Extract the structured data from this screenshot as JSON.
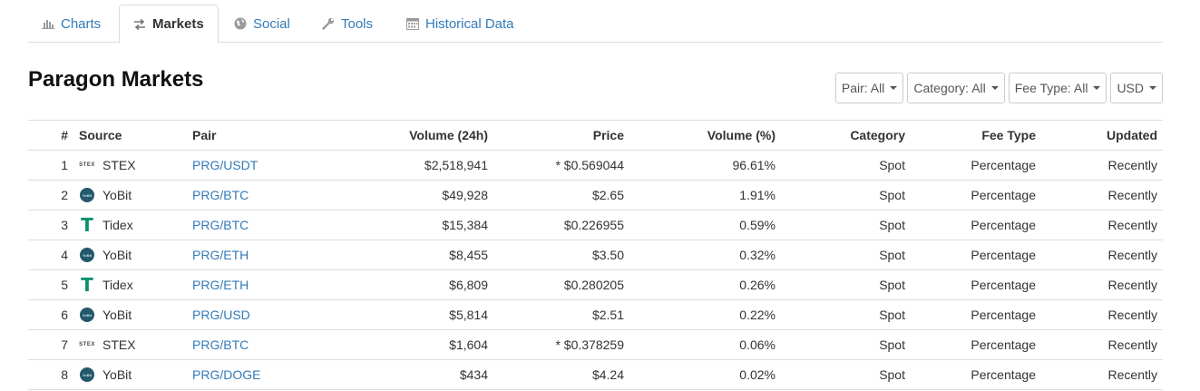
{
  "tabs": [
    {
      "label": "Charts",
      "icon": "bar-chart-icon",
      "active": false
    },
    {
      "label": "Markets",
      "icon": "exchange-arrows-icon",
      "active": true
    },
    {
      "label": "Social",
      "icon": "globe-icon",
      "active": false
    },
    {
      "label": "Tools",
      "icon": "wrench-icon",
      "active": false
    },
    {
      "label": "Historical Data",
      "icon": "calendar-icon",
      "active": false
    }
  ],
  "page_title": "Paragon Markets",
  "filters": {
    "pair": "Pair: All",
    "category": "Category: All",
    "fee_type": "Fee Type: All",
    "currency": "USD"
  },
  "table": {
    "headers": {
      "rank": "#",
      "source": "Source",
      "pair": "Pair",
      "volume": "Volume (24h)",
      "price": "Price",
      "volume_pct": "Volume (%)",
      "category": "Category",
      "fee_type": "Fee Type",
      "updated": "Updated"
    },
    "rows": [
      {
        "rank": "1",
        "source": "STEX",
        "logo": "stex",
        "logo_text": "STEX",
        "pair": "PRG/USDT",
        "volume": "$2,518,941",
        "price": "* $0.569044",
        "volume_pct": "96.61%",
        "category": "Spot",
        "fee_type": "Percentage",
        "updated": "Recently"
      },
      {
        "rank": "2",
        "source": "YoBit",
        "logo": "yobit",
        "logo_text": "YoBit",
        "pair": "PRG/BTC",
        "volume": "$49,928",
        "price": "$2.65",
        "volume_pct": "1.91%",
        "category": "Spot",
        "fee_type": "Percentage",
        "updated": "Recently"
      },
      {
        "rank": "3",
        "source": "Tidex",
        "logo": "tidex",
        "logo_text": "T",
        "pair": "PRG/BTC",
        "volume": "$15,384",
        "price": "$0.226955",
        "volume_pct": "0.59%",
        "category": "Spot",
        "fee_type": "Percentage",
        "updated": "Recently"
      },
      {
        "rank": "4",
        "source": "YoBit",
        "logo": "yobit",
        "logo_text": "YoBit",
        "pair": "PRG/ETH",
        "volume": "$8,455",
        "price": "$3.50",
        "volume_pct": "0.32%",
        "category": "Spot",
        "fee_type": "Percentage",
        "updated": "Recently"
      },
      {
        "rank": "5",
        "source": "Tidex",
        "logo": "tidex",
        "logo_text": "T",
        "pair": "PRG/ETH",
        "volume": "$6,809",
        "price": "$0.280205",
        "volume_pct": "0.26%",
        "category": "Spot",
        "fee_type": "Percentage",
        "updated": "Recently"
      },
      {
        "rank": "6",
        "source": "YoBit",
        "logo": "yobit",
        "logo_text": "YoBit",
        "pair": "PRG/USD",
        "volume": "$5,814",
        "price": "$2.51",
        "volume_pct": "0.22%",
        "category": "Spot",
        "fee_type": "Percentage",
        "updated": "Recently"
      },
      {
        "rank": "7",
        "source": "STEX",
        "logo": "stex",
        "logo_text": "STEX",
        "pair": "PRG/BTC",
        "volume": "$1,604",
        "price": "* $0.378259",
        "volume_pct": "0.06%",
        "category": "Spot",
        "fee_type": "Percentage",
        "updated": "Recently"
      },
      {
        "rank": "8",
        "source": "YoBit",
        "logo": "yobit",
        "logo_text": "YoBit",
        "pair": "PRG/DOGE",
        "volume": "$434",
        "price": "$4.24",
        "volume_pct": "0.02%",
        "category": "Spot",
        "fee_type": "Percentage",
        "updated": "Recently"
      }
    ]
  },
  "colors": {
    "link": "#337ab7",
    "border": "#dddddd",
    "yobit_logo": "#23596b",
    "tidex_logo": "#0c8f6d"
  }
}
